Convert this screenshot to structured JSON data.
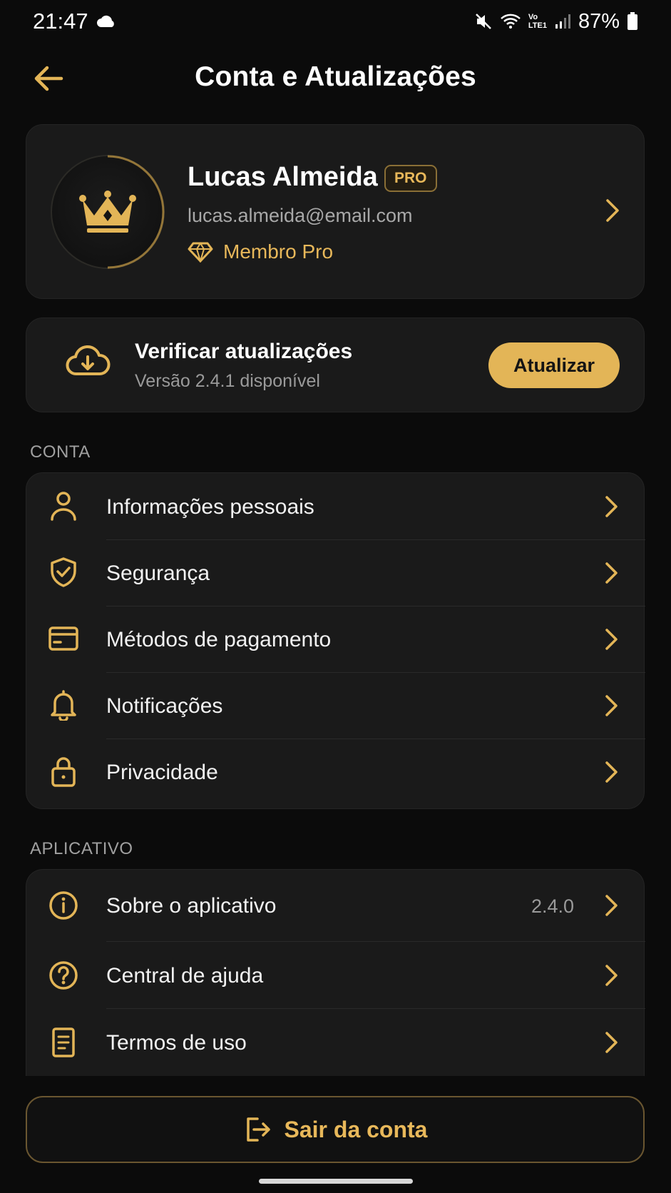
{
  "status_bar": {
    "time": "21:47",
    "battery": "87%"
  },
  "header": {
    "title": "Conta e Atualizações"
  },
  "profile": {
    "name": "Lucas Almeida",
    "badge": "PRO",
    "email": "lucas.almeida@email.com",
    "membership": "Membro Pro"
  },
  "update": {
    "title": "Verificar atualizações",
    "subtitle": "Versão 2.4.1 disponível",
    "button_label": "Atualizar"
  },
  "account_section": {
    "label": "CONTA",
    "items": [
      {
        "label": "Informações pessoais",
        "icon": "user-icon"
      },
      {
        "label": "Segurança",
        "icon": "shield-check-icon"
      },
      {
        "label": "Métodos de pagamento",
        "icon": "credit-card-icon"
      },
      {
        "label": "Notificações",
        "icon": "bell-icon"
      },
      {
        "label": "Privacidade",
        "icon": "lock-icon"
      }
    ]
  },
  "app_section": {
    "label": "APLICATIVO",
    "items": [
      {
        "label": "Sobre o aplicativo",
        "value": "2.4.0",
        "icon": "info-icon"
      },
      {
        "label": "Central de ajuda",
        "icon": "help-icon"
      },
      {
        "label": "Termos de uso",
        "icon": "document-icon"
      }
    ]
  },
  "logout": {
    "label": "Sair da conta"
  },
  "colors": {
    "accent": "#e3b557",
    "background": "#0b0b0b",
    "card": "#1a1a1a"
  }
}
